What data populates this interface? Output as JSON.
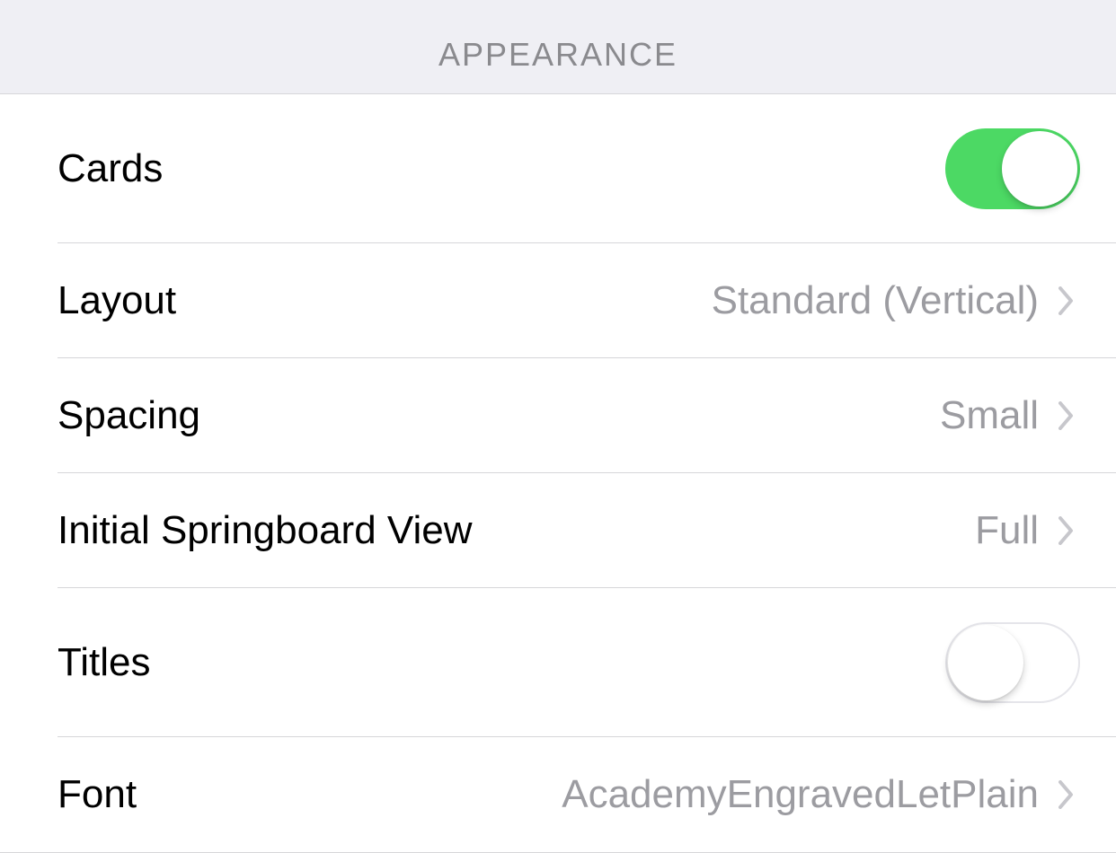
{
  "section": {
    "title": "APPEARANCE"
  },
  "rows": {
    "cards": {
      "label": "Cards",
      "toggle_on": true
    },
    "layout": {
      "label": "Layout",
      "value": "Standard (Vertical)"
    },
    "spacing": {
      "label": "Spacing",
      "value": "Small"
    },
    "initial_springboard_view": {
      "label": "Initial Springboard View",
      "value": "Full"
    },
    "titles": {
      "label": "Titles",
      "toggle_on": false
    },
    "font": {
      "label": "Font",
      "value": "AcademyEngravedLetPlain"
    }
  },
  "colors": {
    "background": "#efeff4",
    "row_bg": "#ffffff",
    "separator": "#d6d6d9",
    "header_text": "#8a8a8e",
    "label_text": "#000000",
    "value_text": "#9c9ca1",
    "chevron": "#c7c7cc",
    "toggle_on": "#4cd964",
    "toggle_off_border": "#e5e5ea"
  }
}
